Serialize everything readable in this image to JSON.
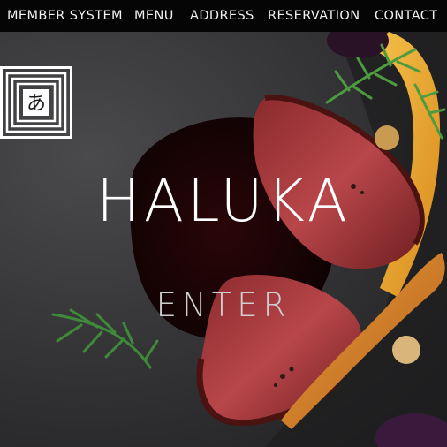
{
  "nav": {
    "items": [
      {
        "label": "MEMBER SYSTEM"
      },
      {
        "label": "MENU"
      },
      {
        "label": "ADDRESS"
      },
      {
        "label": "RESERVATION"
      },
      {
        "label": "CONTACT"
      }
    ]
  },
  "hero": {
    "brand": "HALUKA",
    "enter_label": "ENTER",
    "logo_glyph": "あ",
    "logo_icon": "square-spiral-logo-icon"
  },
  "colors": {
    "nav_bg": "#050505",
    "nav_text": "#f2f2f2",
    "brand_text": "#ffffff",
    "enter_text": "#cfcfcf"
  }
}
